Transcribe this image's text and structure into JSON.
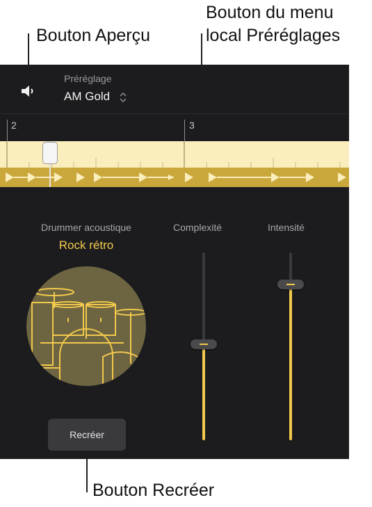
{
  "callouts": {
    "preview": "Bouton Aperçu",
    "preset_menu_line1": "Bouton du menu",
    "preset_menu_line2": "local Préréglages",
    "recreate": "Bouton Recréer"
  },
  "header": {
    "preset_label": "Préréglage",
    "preset_value": "AM Gold"
  },
  "ruler": {
    "bars": [
      "2",
      "3"
    ]
  },
  "drummer": {
    "name": "Drummer acoustique",
    "style": "Rock rétro"
  },
  "sliders": {
    "complexity": {
      "label": "Complexité",
      "value": 0.51
    },
    "intensity": {
      "label": "Intensité",
      "value": 0.83
    }
  },
  "buttons": {
    "recreate": "Recréer"
  },
  "colors": {
    "accent": "#f2c94c",
    "panel": "#1c1c1e",
    "region": "#fbeebd",
    "region_bar": "#c9a73a"
  },
  "icons": [
    "speaker-icon",
    "chevron-updown-icon",
    "drum-kit-icon"
  ]
}
